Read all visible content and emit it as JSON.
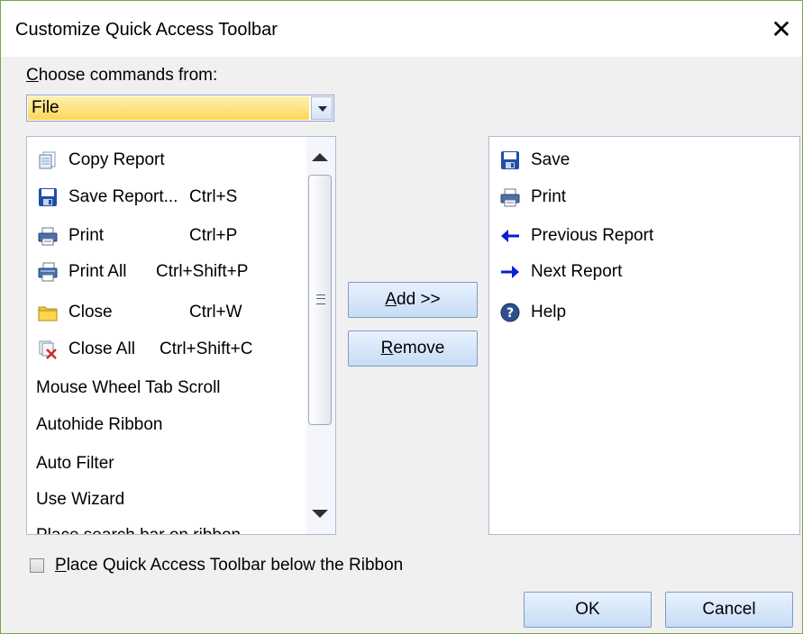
{
  "dialog": {
    "title": "Customize Quick Access Toolbar",
    "close_glyph": "✕",
    "choose_label_first": "C",
    "choose_label_rest": "hoose commands from:",
    "combo": {
      "value": "File"
    }
  },
  "left_list": {
    "items": [
      {
        "label": "Copy Report",
        "shortcut": "",
        "icon": "copy-report-icon"
      },
      {
        "label": "Save Report...",
        "shortcut": "Ctrl+S",
        "icon": "save-icon"
      },
      {
        "label": "Print",
        "shortcut": "Ctrl+P",
        "icon": "printer-icon"
      },
      {
        "label": "Print All",
        "shortcut": "Ctrl+Shift+P",
        "icon": "print-all-icon"
      },
      {
        "label": "Close",
        "shortcut": "Ctrl+W",
        "icon": "folder-icon"
      },
      {
        "label": "Close All",
        "shortcut": "Ctrl+Shift+C",
        "icon": "close-all-icon"
      },
      {
        "label": "Mouse Wheel Tab Scroll",
        "shortcut": "",
        "icon": ""
      },
      {
        "label": "Autohide Ribbon",
        "shortcut": "",
        "icon": ""
      },
      {
        "label": "Auto Filter",
        "shortcut": "",
        "icon": ""
      },
      {
        "label": "Use Wizard",
        "shortcut": "",
        "icon": ""
      },
      {
        "label": "Place search bar on ribbon",
        "shortcut": "",
        "icon": ""
      }
    ]
  },
  "buttons": {
    "add_underlined": "A",
    "add_rest": "dd >>",
    "remove_underlined": "R",
    "remove_rest": "emove",
    "ok": "OK",
    "cancel": "Cancel"
  },
  "right_list": {
    "items": [
      {
        "label": "Save",
        "icon": "save-icon"
      },
      {
        "label": "Print",
        "icon": "printer-icon"
      },
      {
        "label": "Previous Report",
        "icon": "arrow-left-icon"
      },
      {
        "label": "Next Report",
        "icon": "arrow-right-icon"
      },
      {
        "label": "Help",
        "icon": "help-icon"
      }
    ]
  },
  "checkbox": {
    "label_underlined": "P",
    "label_rest": "lace Quick Access Toolbar below the Ribbon",
    "checked": false
  },
  "colors": {
    "combo_highlight": "#ffd65a",
    "window_border": "#7aa843",
    "button_face": "#c7dcf6",
    "arrow_blue": "#0a1fd6"
  }
}
